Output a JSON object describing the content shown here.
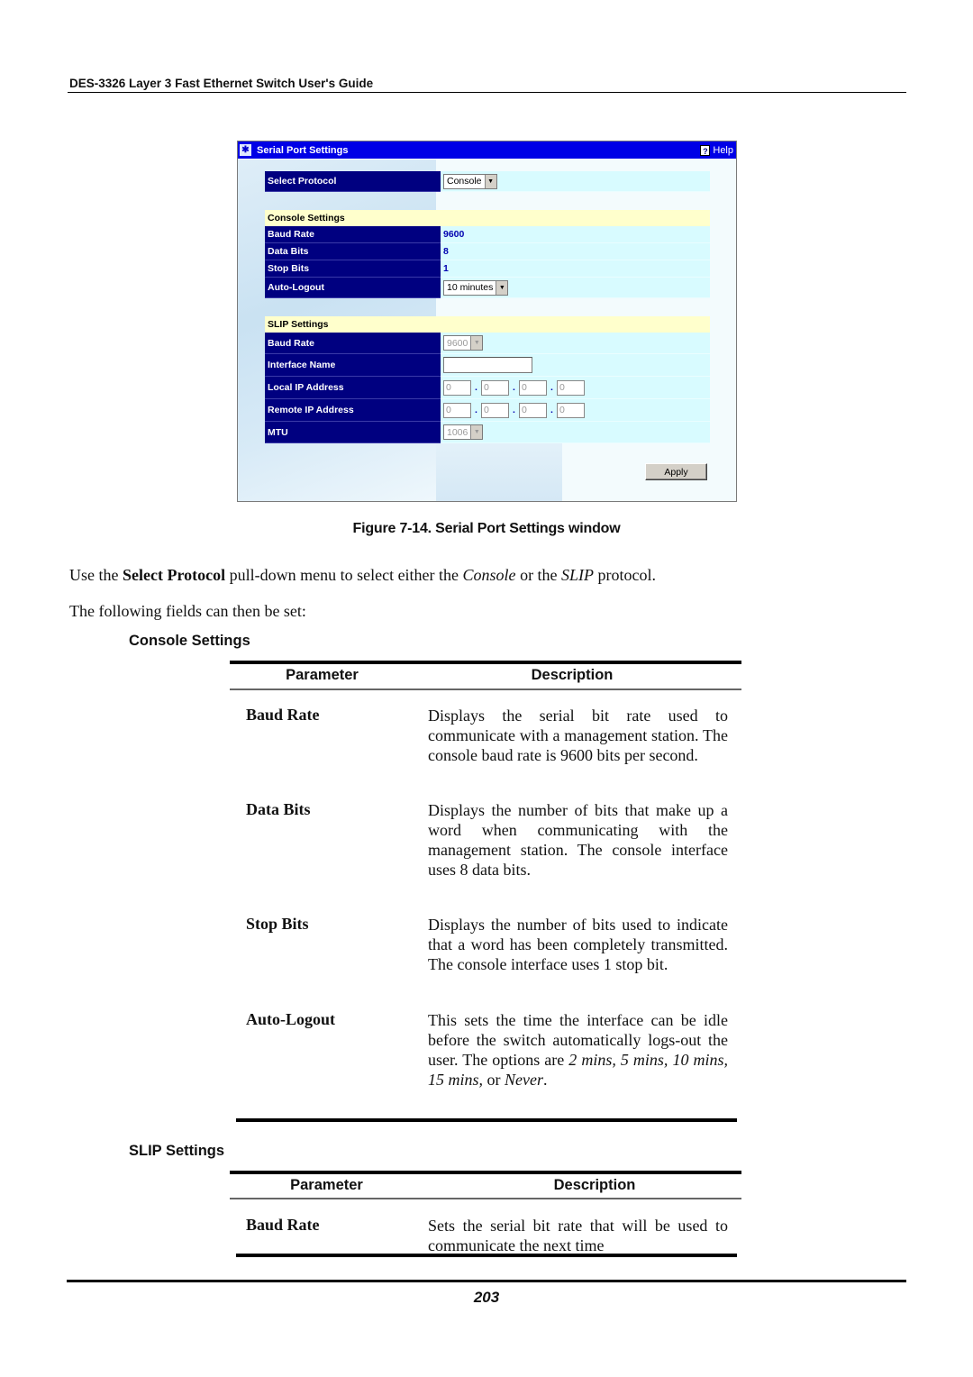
{
  "header": {
    "title": "DES-3326 Layer 3 Fast Ethernet Switch User's Guide"
  },
  "window": {
    "title": "Serial Port Settings",
    "help_label": "Help",
    "select_protocol_label": "Select Protocol",
    "select_protocol_value": "Console",
    "console_section": "Console Settings",
    "console_rows": [
      {
        "label": "Baud Rate",
        "value": "9600"
      },
      {
        "label": "Data Bits",
        "value": "8"
      },
      {
        "label": "Stop Bits",
        "value": "1"
      },
      {
        "label": "Auto-Logout",
        "value": "10 minutes"
      }
    ],
    "slip_section": "SLIP Settings",
    "slip_rows": {
      "baud_rate": {
        "label": "Baud Rate",
        "value": "9600"
      },
      "interface_name": {
        "label": "Interface Name",
        "value": ""
      },
      "local_ip": {
        "label": "Local IP Address",
        "octets": [
          "0",
          "0",
          "0",
          "0"
        ]
      },
      "remote_ip": {
        "label": "Remote IP Address",
        "octets": [
          "0",
          "0",
          "0",
          "0"
        ]
      },
      "mtu": {
        "label": "MTU",
        "value": "1006"
      }
    },
    "ip_separator": ".",
    "apply_label": "Apply"
  },
  "figure_caption": "Figure 7-14.  Serial Port Settings window",
  "intro": {
    "p1_a": "Use the ",
    "p1_b": "Select Protocol",
    "p1_c": " pull-down menu to select either the ",
    "p1_d": "Console",
    "p1_e": " or the ",
    "p1_f": "SLIP",
    "p1_g": " protocol.",
    "p2": "The following fields can then be set:"
  },
  "console_table": {
    "heading": "Console Settings",
    "col_param": "Parameter",
    "col_desc": "Description",
    "rows": [
      {
        "param": "Baud Rate",
        "desc": "Displays the serial bit rate used to communicate with a management station. The console baud rate is 9600 bits per second."
      },
      {
        "param": "Data Bits",
        "desc": "Displays the number of bits that make up a word when communicating with the management station. The console interface uses 8 data bits."
      },
      {
        "param": "Stop Bits",
        "desc": "Displays the number of bits used to indicate that a word has been completely transmitted.  The console interface uses 1 stop bit."
      },
      {
        "param": "Auto-Logout",
        "desc_a": "This sets the time the interface can be idle before the switch automatically logs-out the user. The options are ",
        "desc_opts": "2 mins, 5 mins, 10 mins, 15 mins,",
        "desc_b": " or ",
        "desc_never": "Never",
        "desc_c": "."
      }
    ]
  },
  "slip_table": {
    "heading": "SLIP Settings",
    "col_param": "Parameter",
    "col_desc": "Description",
    "rows": [
      {
        "param": "Baud Rate",
        "desc": "Sets the serial bit rate that will be used to communicate the next time"
      }
    ]
  },
  "footer": {
    "page_number": "203"
  }
}
